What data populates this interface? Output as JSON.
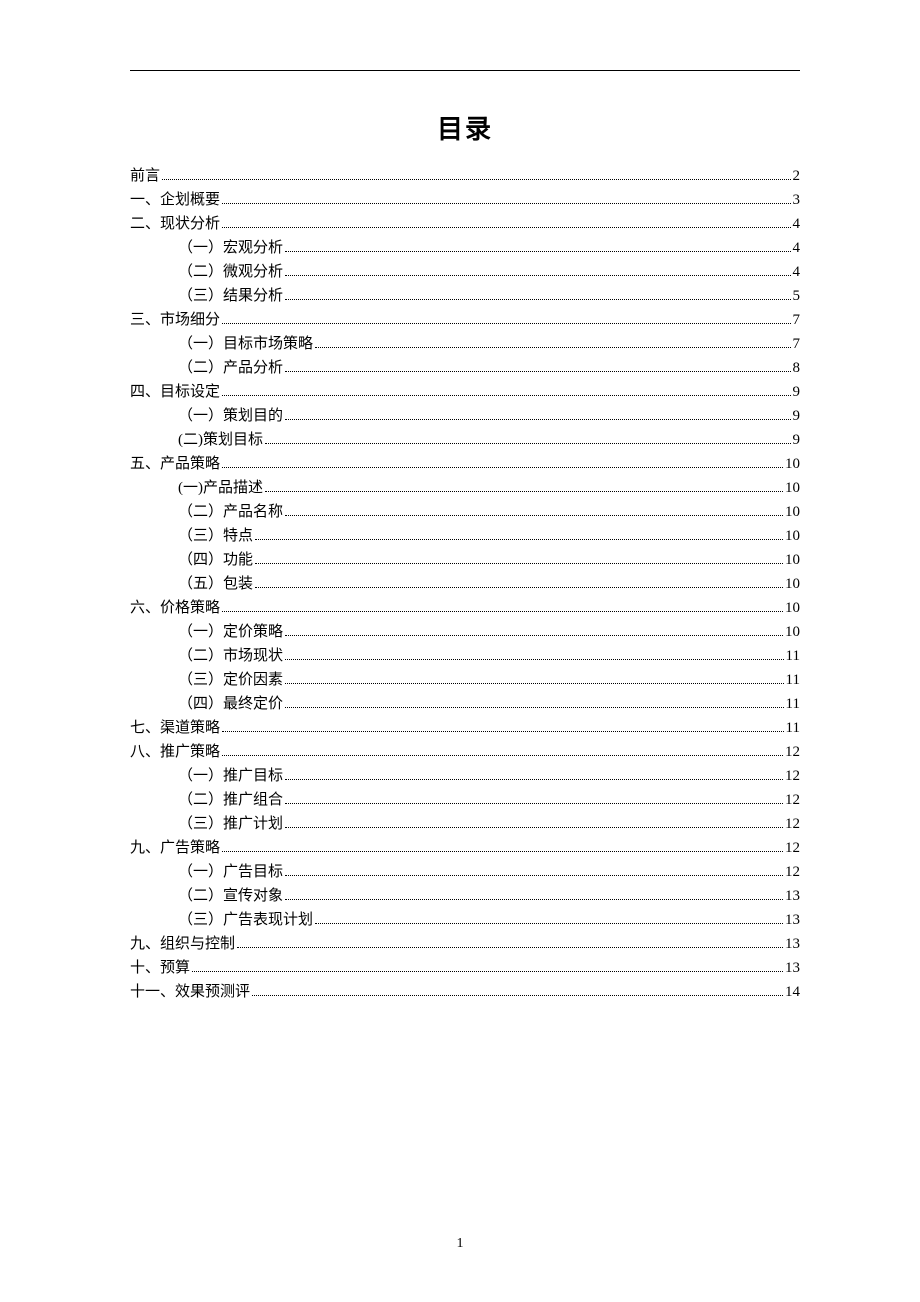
{
  "title": "目录",
  "footer_page_number": "1",
  "toc": [
    {
      "level": 0,
      "label": "前言",
      "page": "2"
    },
    {
      "level": 0,
      "label": "一、企划概要",
      "page": "3"
    },
    {
      "level": 0,
      "label": "二、现状分析",
      "page": "4"
    },
    {
      "level": 1,
      "label": "（一）宏观分析",
      "page": "4"
    },
    {
      "level": 1,
      "label": "（二）微观分析",
      "page": "4"
    },
    {
      "level": 1,
      "label": "（三）结果分析",
      "page": "5"
    },
    {
      "level": 0,
      "label": "三、市场细分",
      "page": "7"
    },
    {
      "level": 1,
      "label": "（一）目标市场策略",
      "page": "7"
    },
    {
      "level": 1,
      "label": "（二）产品分析",
      "page": "8"
    },
    {
      "level": 0,
      "label": "四、目标设定",
      "page": "9"
    },
    {
      "level": 1,
      "label": "（一）策划目的",
      "page": "9"
    },
    {
      "level": 1,
      "label": "(二)策划目标",
      "page": "9"
    },
    {
      "level": 0,
      "label": "五、产品策略",
      "page": "10"
    },
    {
      "level": 1,
      "label": "(一)产品描述",
      "page": "10"
    },
    {
      "level": 1,
      "label": "（二）产品名称",
      "page": "10"
    },
    {
      "level": 1,
      "label": "（三）特点",
      "page": "10"
    },
    {
      "level": 1,
      "label": "（四）功能",
      "page": "10"
    },
    {
      "level": 1,
      "label": "（五）包装",
      "page": "10"
    },
    {
      "level": 0,
      "label": "六、价格策略",
      "page": "10"
    },
    {
      "level": 1,
      "label": "（一）定价策略",
      "page": "10"
    },
    {
      "level": 1,
      "label": "（二）市场现状",
      "page": "11"
    },
    {
      "level": 1,
      "label": "（三）定价因素",
      "page": "11"
    },
    {
      "level": 1,
      "label": "（四）最终定价",
      "page": "11"
    },
    {
      "level": 0,
      "label": "七、渠道策略",
      "page": "11"
    },
    {
      "level": 0,
      "label": "八、推广策略",
      "page": "12"
    },
    {
      "level": 1,
      "label": "（一）推广目标",
      "page": "12"
    },
    {
      "level": 1,
      "label": "（二）推广组合",
      "page": "12"
    },
    {
      "level": 1,
      "label": "（三）推广计划",
      "page": "12"
    },
    {
      "level": 0,
      "label": "九、广告策略",
      "page": "12"
    },
    {
      "level": 1,
      "label": "（一）广告目标",
      "page": "12"
    },
    {
      "level": 1,
      "label": "（二）宣传对象",
      "page": "13"
    },
    {
      "level": 1,
      "label": "（三）广告表现计划",
      "page": "13"
    },
    {
      "level": 0,
      "label": "九、组织与控制",
      "page": "13"
    },
    {
      "level": 0,
      "label": "十、预算",
      "page": "13"
    },
    {
      "level": 0,
      "label": "十一、效果预测评",
      "page": "14"
    }
  ]
}
